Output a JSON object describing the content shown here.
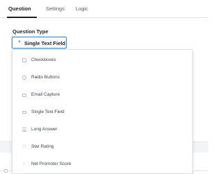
{
  "tabs": [
    {
      "label": "Question",
      "active": true
    },
    {
      "label": "Settings",
      "active": false
    },
    {
      "label": "Logic",
      "active": false
    }
  ],
  "question_type": {
    "label": "Question Type",
    "selected": "Single Text Field",
    "caret_icon": "chevron-down-icon"
  },
  "dropdown": {
    "options": [
      {
        "label": "Checkboxes",
        "icon": "checkbox-icon"
      },
      {
        "label": "Radio Buttons",
        "icon": "radio-icon"
      },
      {
        "label": "Email Capture",
        "icon": "envelope-icon"
      },
      {
        "label": "Single Text Field",
        "icon": "text-field-icon"
      },
      {
        "label": "Long Answer",
        "icon": "paragraph-icon"
      },
      {
        "label": "Star Rating",
        "icon": "star-icon"
      },
      {
        "label": "Net Promoter Score",
        "icon": "gauge-icon"
      }
    ]
  },
  "colors": {
    "accent_border": "#4a90c8",
    "active_tab": "#1e1e1e"
  }
}
